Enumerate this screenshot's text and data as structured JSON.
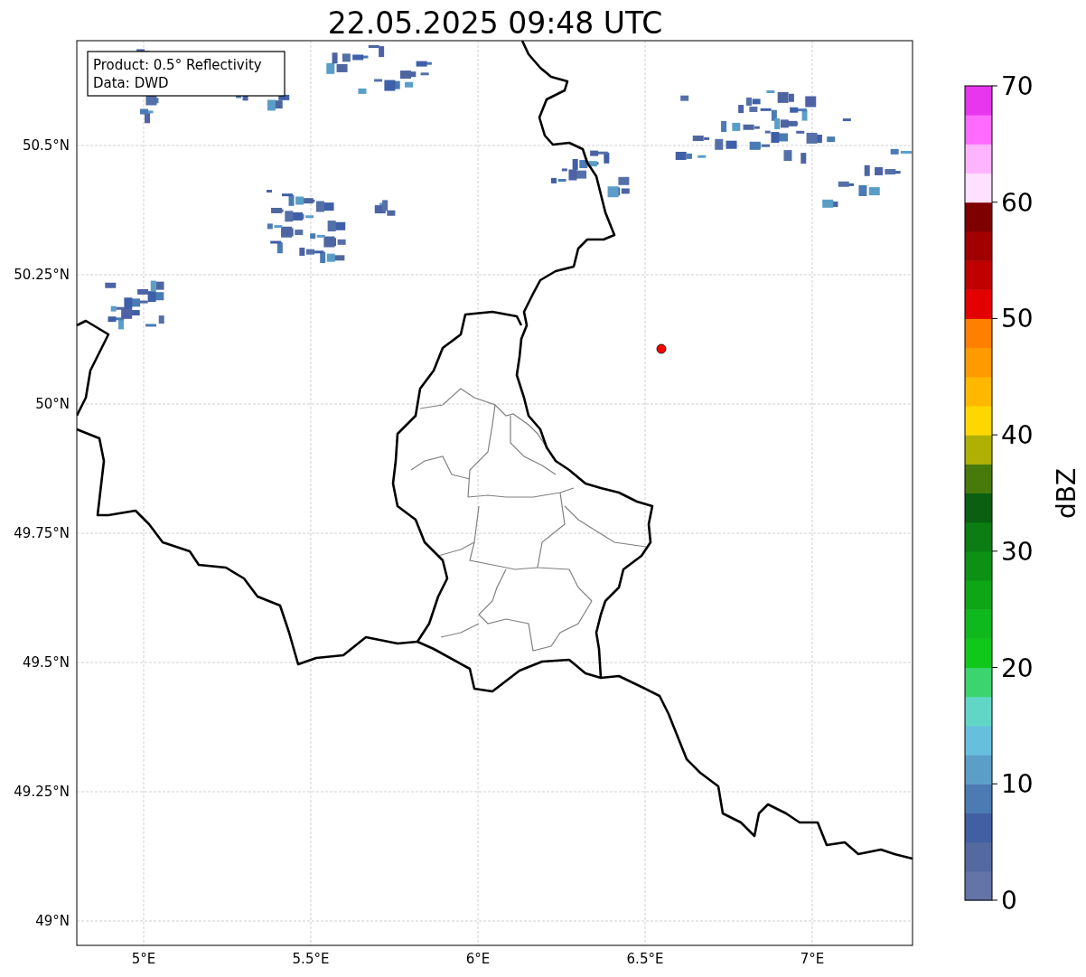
{
  "title": "22.05.2025 09:48 UTC",
  "map": {
    "info_box": [
      "Product: 0.5° Reflectivity",
      "Data: DWD"
    ],
    "lat_ticks": [
      "50.5°N",
      "50.25°N",
      "50°N",
      "49.75°N",
      "49.5°N",
      "49.25°N",
      "49°N"
    ],
    "lon_ticks": [
      "5°E",
      "5.5°E",
      "6°E",
      "6.5°E",
      "7°E"
    ]
  },
  "colorbar": {
    "label": "dBZ",
    "ticks": [
      "70",
      "60",
      "50",
      "40",
      "30",
      "20",
      "10",
      "0"
    ],
    "bins": [
      {
        "color": "#6473a8"
      },
      {
        "color": "#5469a0"
      },
      {
        "color": "#435fa3"
      },
      {
        "color": "#4c7ab2"
      },
      {
        "color": "#5b9ec7"
      },
      {
        "color": "#66bfdc"
      },
      {
        "color": "#62d6c6"
      },
      {
        "color": "#3cd46f"
      },
      {
        "color": "#10c81a"
      },
      {
        "color": "#0fb81c"
      },
      {
        "color": "#0ea517"
      },
      {
        "color": "#0c9114"
      },
      {
        "color": "#0b7d12"
      },
      {
        "color": "#0a5f10"
      },
      {
        "color": "#477a0b"
      },
      {
        "color": "#b0b004"
      },
      {
        "color": "#ffd700"
      },
      {
        "color": "#ffb700"
      },
      {
        "color": "#ff9a00"
      },
      {
        "color": "#ff7f00"
      },
      {
        "color": "#e30000"
      },
      {
        "color": "#c00000"
      },
      {
        "color": "#a00000"
      },
      {
        "color": "#7e0000"
      },
      {
        "color": "#ffe0ff"
      },
      {
        "color": "#ffb4ff"
      },
      {
        "color": "#ff6bff"
      },
      {
        "color": "#e835ee"
      }
    ]
  }
}
